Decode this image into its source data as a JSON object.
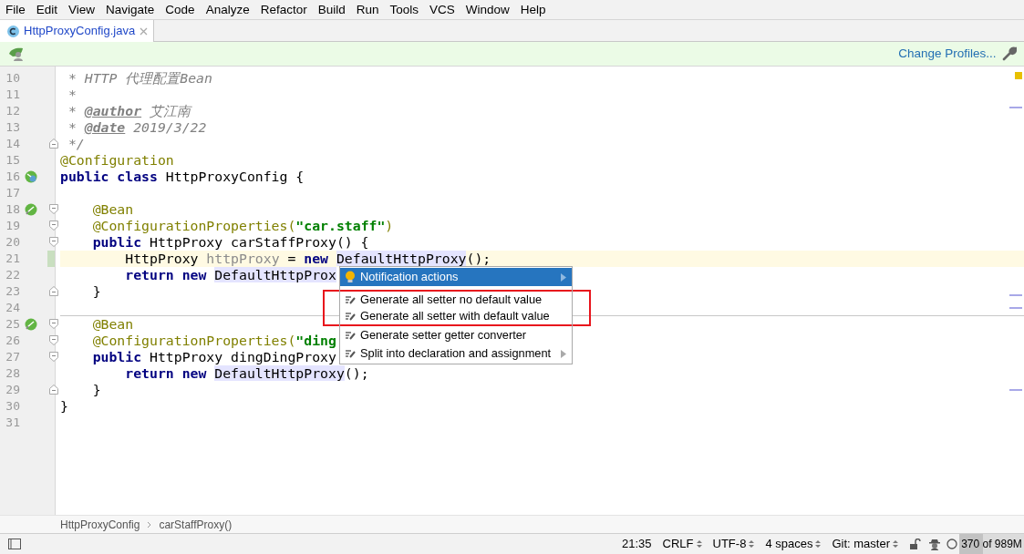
{
  "menu": [
    "File",
    "Edit",
    "View",
    "Navigate",
    "Code",
    "Analyze",
    "Refactor",
    "Build",
    "Run",
    "Tools",
    "VCS",
    "Window",
    "Help"
  ],
  "tabs": [
    {
      "label": "HttpProxyConfig.java",
      "selected": true
    }
  ],
  "banner": {
    "link": "Change Profiles..."
  },
  "editor": {
    "lines": [
      {
        "number": "10",
        "tokens": [
          {
            "text": " * HTTP 代理配置Bean",
            "kind": "comment"
          }
        ]
      },
      {
        "number": "11",
        "tokens": [
          {
            "text": " *",
            "kind": "comment"
          }
        ]
      },
      {
        "number": "12",
        "tokens": [
          {
            "text": " * ",
            "kind": "comment"
          },
          {
            "text": "@author",
            "kind": "doctag"
          },
          {
            "text": " 艾江南",
            "kind": "comment"
          }
        ]
      },
      {
        "number": "13",
        "tokens": [
          {
            "text": " * ",
            "kind": "comment"
          },
          {
            "text": "@date",
            "kind": "doctag"
          },
          {
            "text": " 2019/3/22",
            "kind": "comment"
          }
        ]
      },
      {
        "number": "14",
        "fold": {
          "kind": "end"
        },
        "tokens": [
          {
            "text": " */",
            "kind": "comment"
          }
        ]
      },
      {
        "number": "15",
        "tokens": [
          {
            "text": "@Configuration",
            "kind": "annotation"
          }
        ]
      },
      {
        "number": "16",
        "gutter_icon": {
          "kind": "bean-class"
        },
        "tokens": [
          {
            "text": "public class",
            "kind": "keyword"
          },
          {
            "text": " HttpProxyConfig {",
            "kind": "plain"
          }
        ]
      },
      {
        "number": "17"
      },
      {
        "number": "18",
        "gutter_icon": {
          "kind": "bean"
        },
        "fold": {
          "kind": "start"
        },
        "tokens": [
          {
            "text": "    @Bean",
            "kind": "annotation"
          }
        ]
      },
      {
        "number": "19",
        "fold": {
          "kind": "start"
        },
        "tokens": [
          {
            "text": "    @ConfigurationProperties(",
            "kind": "annotation"
          },
          {
            "text": "\"car.staff\"",
            "kind": "string"
          },
          {
            "text": ")",
            "kind": "annotation"
          }
        ]
      },
      {
        "number": "20",
        "fold": {
          "kind": "start"
        },
        "tokens": [
          {
            "text": "    public",
            "kind": "keyword"
          },
          {
            "text": " HttpProxy carStaffProxy() {",
            "kind": "plain"
          }
        ]
      },
      {
        "number": "21",
        "current": true,
        "changed": true,
        "tokens": [
          {
            "text": "        HttpProxy ",
            "kind": "plain"
          },
          {
            "text": "httpProxy",
            "kind": "unused"
          },
          {
            "text": " = ",
            "kind": "plain"
          },
          {
            "text": "new ",
            "kind": "keyword"
          },
          {
            "text": "DefaultHttpProxy",
            "kind": "usage"
          },
          {
            "text": "();",
            "kind": "plain"
          }
        ]
      },
      {
        "number": "22",
        "tokens": [
          {
            "text": "        return new ",
            "kind": "keyword"
          },
          {
            "text": "DefaultHttpProx",
            "kind": "usage"
          }
        ]
      },
      {
        "number": "23",
        "fold": {
          "kind": "end"
        },
        "tokens": [
          {
            "text": "    }",
            "kind": "plain"
          }
        ]
      },
      {
        "number": "24",
        "separator": true
      },
      {
        "number": "25",
        "gutter_icon": {
          "kind": "bean"
        },
        "fold": {
          "kind": "start"
        },
        "tokens": [
          {
            "text": "    @Bean",
            "kind": "annotation"
          }
        ]
      },
      {
        "number": "26",
        "fold": {
          "kind": "start"
        },
        "tokens": [
          {
            "text": "    @ConfigurationProperties(",
            "kind": "annotation"
          },
          {
            "text": "\"ding",
            "kind": "string"
          }
        ]
      },
      {
        "number": "27",
        "fold": {
          "kind": "start"
        },
        "tokens": [
          {
            "text": "    public",
            "kind": "keyword"
          },
          {
            "text": " HttpProxy dingDingProxy",
            "kind": "plain"
          }
        ]
      },
      {
        "number": "28",
        "tokens": [
          {
            "text": "        return new ",
            "kind": "keyword"
          },
          {
            "text": "DefaultHttpProxy",
            "kind": "usage"
          },
          {
            "text": "();",
            "kind": "plain"
          }
        ]
      },
      {
        "number": "29",
        "fold": {
          "kind": "end"
        },
        "tokens": [
          {
            "text": "    }",
            "kind": "plain"
          }
        ]
      },
      {
        "number": "30",
        "tokens": [
          {
            "text": "}",
            "kind": "plain"
          }
        ]
      },
      {
        "number": "31"
      }
    ]
  },
  "popup": {
    "items": [
      {
        "label": "Notification actions",
        "kind": "bulb",
        "selected": true,
        "submenu": true,
        "framed": false
      },
      {
        "label": "Generate all setter no default value",
        "kind": "intention",
        "selected": false,
        "submenu": false,
        "framed": true
      },
      {
        "label": "Generate all setter with default value",
        "kind": "intention",
        "selected": false,
        "submenu": false,
        "framed": true
      },
      {
        "label": "Generate setter getter converter",
        "kind": "intention",
        "selected": false,
        "submenu": false,
        "framed": false
      },
      {
        "label": "Split into declaration and assignment",
        "kind": "intention",
        "selected": false,
        "submenu": true,
        "framed": false
      }
    ]
  },
  "breadcrumbs": [
    "HttpProxyConfig",
    "carStaffProxy()"
  ],
  "status_bar": {
    "position": "21:35",
    "widgets": [
      "CRLF",
      "UTF-8",
      "4 spaces",
      "Git: master"
    ],
    "memory": {
      "text": "370 of 989M",
      "level": 0.37
    }
  }
}
